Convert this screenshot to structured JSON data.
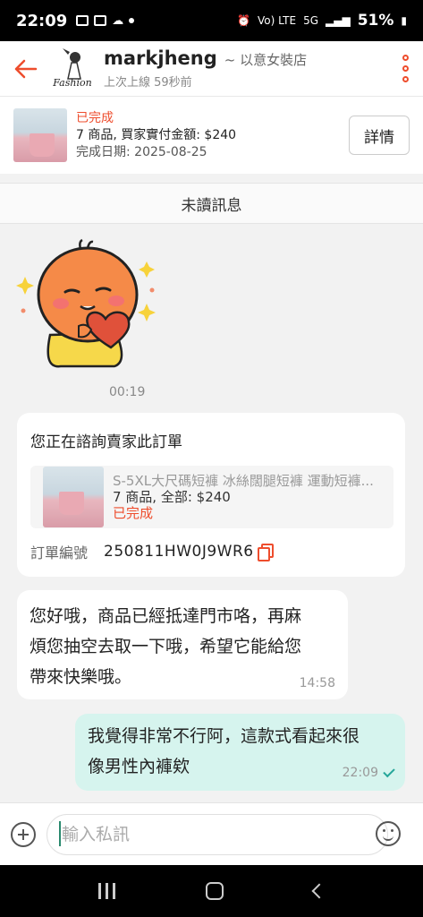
{
  "status_bar": {
    "time": "22:09",
    "network": "Vo) LTE",
    "network_5g": "5G",
    "battery": "51%",
    "icons": [
      "photo-icon",
      "webtoon-icon",
      "cloud-icon",
      "dot-icon",
      "alarm-icon",
      "signal-icon",
      "battery-icon"
    ]
  },
  "header": {
    "username": "markjheng",
    "shop_name": "~ 以意女裝店",
    "last_seen": "上次上線 59秒前",
    "logo_text": "Fashion",
    "accent_color": "#ee4d2d"
  },
  "order": {
    "status": "已完成",
    "summary": "7 商品, 買家實付金額: $240",
    "completed_date": "完成日期: 2025-08-25",
    "details_button": "詳情"
  },
  "divider": {
    "unread_label": "未讀訊息"
  },
  "sticker": {
    "time": "00:19"
  },
  "inquiry_card": {
    "title": "您正在諮詢賣家此訂單",
    "product_name": "S-5XL大尺碼短褲 冰絲闊腿短褲 運動短褲...",
    "product_meta": "7 商品, 全部: $240",
    "product_status": "已完成",
    "order_label": "訂單編號",
    "order_number": "250811HW0J9WR6"
  },
  "messages": [
    {
      "direction": "incoming",
      "text": "您好哦，商品已經抵達門市咯，再麻煩您抽空去取一下哦，希望它能給您帶來快樂哦。",
      "lines": [
        "您好哦，商品已經抵達門市咯，再麻",
        "煩您抽空去取一下哦，希望它能給您",
        "帶來快樂哦。"
      ],
      "time": "14:58"
    },
    {
      "direction": "outgoing",
      "text": "我覺得非常不行阿，這款式看起來很像男性內褲欸",
      "lines": [
        "我覺得非常不行阿，這款式看起來很",
        "像男性內褲欸"
      ],
      "time": "22:09"
    }
  ],
  "composer": {
    "placeholder": "輸入私訊",
    "value": ""
  }
}
